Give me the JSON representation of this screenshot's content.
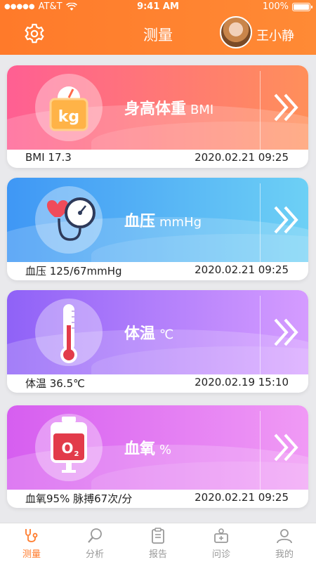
{
  "status_bar": {
    "carrier": "AT&T",
    "time": "9:41 AM",
    "battery": "100%"
  },
  "header": {
    "title": "测量",
    "username": "王小静"
  },
  "cards": [
    {
      "name": "bmi",
      "label": "身高体重",
      "unit": "BMI",
      "value": "BMI 17.3",
      "time": "2020.02.21 09:25",
      "colors": [
        "#ff5f93",
        "#ff8f5a"
      ],
      "icon": "weight-scale-icon"
    },
    {
      "name": "blood-pressure",
      "label": "血压",
      "unit": "mmHg",
      "value": "血压 125/67mmHg",
      "time": "2020.02.21 09:25",
      "colors": [
        "#3f97f5",
        "#6dd0f5"
      ],
      "icon": "blood-pressure-gauge-icon"
    },
    {
      "name": "temperature",
      "label": "体温",
      "unit": "℃",
      "value": "体温 36.5℃",
      "time": "2020.02.19 15:10",
      "colors": [
        "#8f62f7",
        "#d59cff"
      ],
      "icon": "thermometer-icon"
    },
    {
      "name": "blood-oxygen",
      "label": "血氧",
      "unit": "%",
      "value": "血氧95% 脉搏67次/分",
      "time": "2020.02.21 09:25",
      "colors": [
        "#d65ef0",
        "#f09af5"
      ],
      "icon": "oxygen-bag-icon"
    }
  ],
  "tabs": [
    {
      "label": "测量",
      "icon": "stethoscope-icon",
      "active": true
    },
    {
      "label": "分析",
      "icon": "magnifier-icon",
      "active": false
    },
    {
      "label": "报告",
      "icon": "clipboard-icon",
      "active": false
    },
    {
      "label": "问诊",
      "icon": "medical-kit-icon",
      "active": false
    },
    {
      "label": "我的",
      "icon": "person-icon",
      "active": false
    }
  ]
}
